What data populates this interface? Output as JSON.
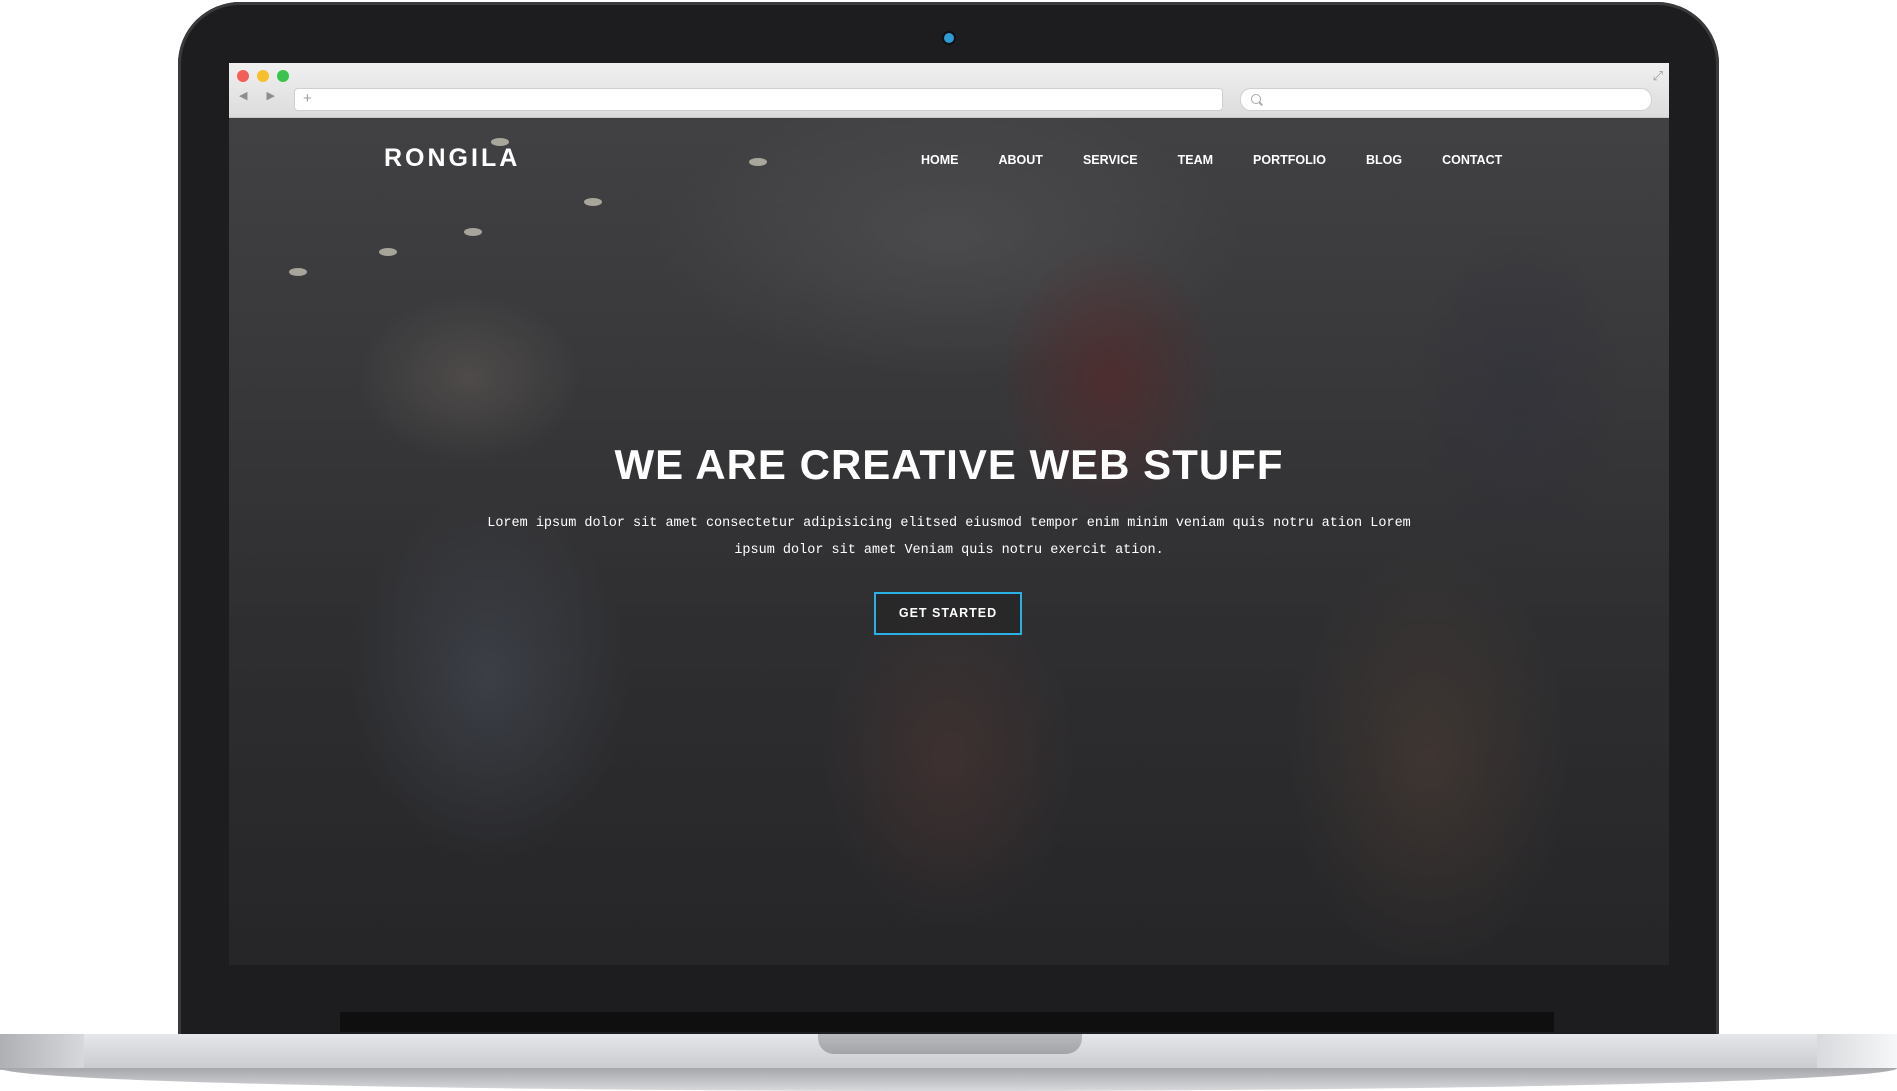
{
  "browser": {
    "traffic_lights": {
      "close_color": "#f25f57",
      "minimize_color": "#f5c02b",
      "zoom_color": "#3bc44b"
    },
    "nav_arrows_icon": "back-forward-icon",
    "new_tab_icon": "+",
    "search_icon": "search-icon",
    "expand_icon": "expand-icon"
  },
  "site": {
    "logo": "RONGILA",
    "nav": [
      {
        "label": "HOME"
      },
      {
        "label": "ABOUT"
      },
      {
        "label": "SERVICE"
      },
      {
        "label": "TEAM"
      },
      {
        "label": "PORTFOLIO"
      },
      {
        "label": "BLOG"
      },
      {
        "label": "CONTACT"
      }
    ],
    "hero": {
      "title": "WE ARE CREATIVE WEB STUFF",
      "text": "Lorem ipsum dolor sit amet consectetur adipisicing elitsed eiusmod tempor enim minim veniam quis notru ation Lorem ipsum dolor sit amet Veniam quis notru exercit ation.",
      "cta_label": "GET STARTED",
      "cta_border_color": "#2bb0e6"
    }
  },
  "device": {
    "camera_color": "#2d9bd6"
  }
}
